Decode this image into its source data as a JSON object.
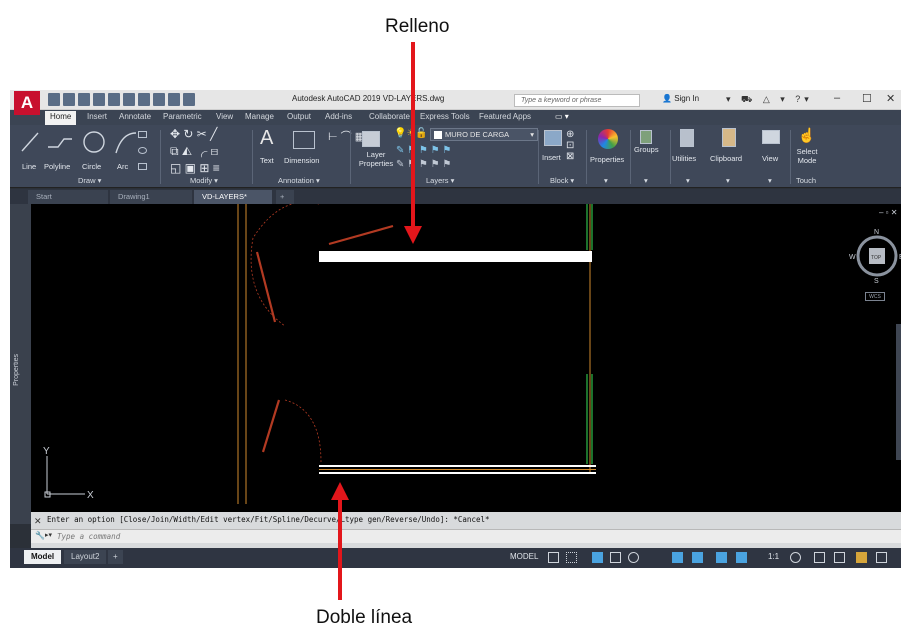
{
  "annotations": {
    "top_label": "Relleno",
    "bottom_label": "Doble línea",
    "arrow_color": "#e3161b"
  },
  "titlebar": {
    "logo": "A",
    "title": "Autodesk AutoCAD 2019   VD-LAYERS.dwg",
    "search_placeholder": "Type a keyword or phrase",
    "sign_in": "Sign In",
    "minimize": "–",
    "maximize": "☐",
    "close": "✕"
  },
  "ribbon_tabs": [
    "Home",
    "Insert",
    "Annotate",
    "Parametric",
    "View",
    "Manage",
    "Output",
    "Add-ins",
    "Collaborate",
    "Express Tools",
    "Featured Apps"
  ],
  "ribbon": {
    "draw": {
      "line": "Line",
      "polyline": "Polyline",
      "circle": "Circle",
      "arc": "Arc",
      "panel": "Draw ▾"
    },
    "modify": {
      "panel": "Modify ▾"
    },
    "annotation": {
      "text": "Text",
      "dimension": "Dimension",
      "panel": "Annotation ▾"
    },
    "layers": {
      "layer_properties": "Layer Properties",
      "current_layer": "MURO DE CARGA",
      "panel": "Layers ▾"
    },
    "block": {
      "insert": "Insert",
      "panel": "Block ▾"
    },
    "properties": "Properties",
    "groups": "Groups",
    "utilities": "Utilities",
    "clipboard": "Clipboard",
    "view": "View",
    "select_mode": "Select Mode",
    "touch": "Touch"
  },
  "doc_tabs": [
    "Start",
    "Drawing1",
    "VD-LAYERS*"
  ],
  "side_palette": "Properties",
  "viewcube": {
    "north": "N",
    "south": "S",
    "east": "E",
    "west": "W",
    "top": "TOP",
    "wcs": "WCS"
  },
  "ucs": {
    "x": "X",
    "y": "Y"
  },
  "command": {
    "history": "Enter an option [Close/Join/Width/Edit vertex/Fit/Spline/Decurve/Ltype gen/Reverse/Undo]: *Cancel*",
    "placeholder": "Type a command"
  },
  "status": {
    "tabs": [
      "Model",
      "Layout2"
    ],
    "model_label": "MODEL",
    "scale": "1:1"
  },
  "colors": {
    "canvas": "#000000",
    "ribbon": "#3f4859",
    "wall_line": "#d08a2e",
    "door": "#b23a22",
    "green_line": "#2fbf4a"
  }
}
